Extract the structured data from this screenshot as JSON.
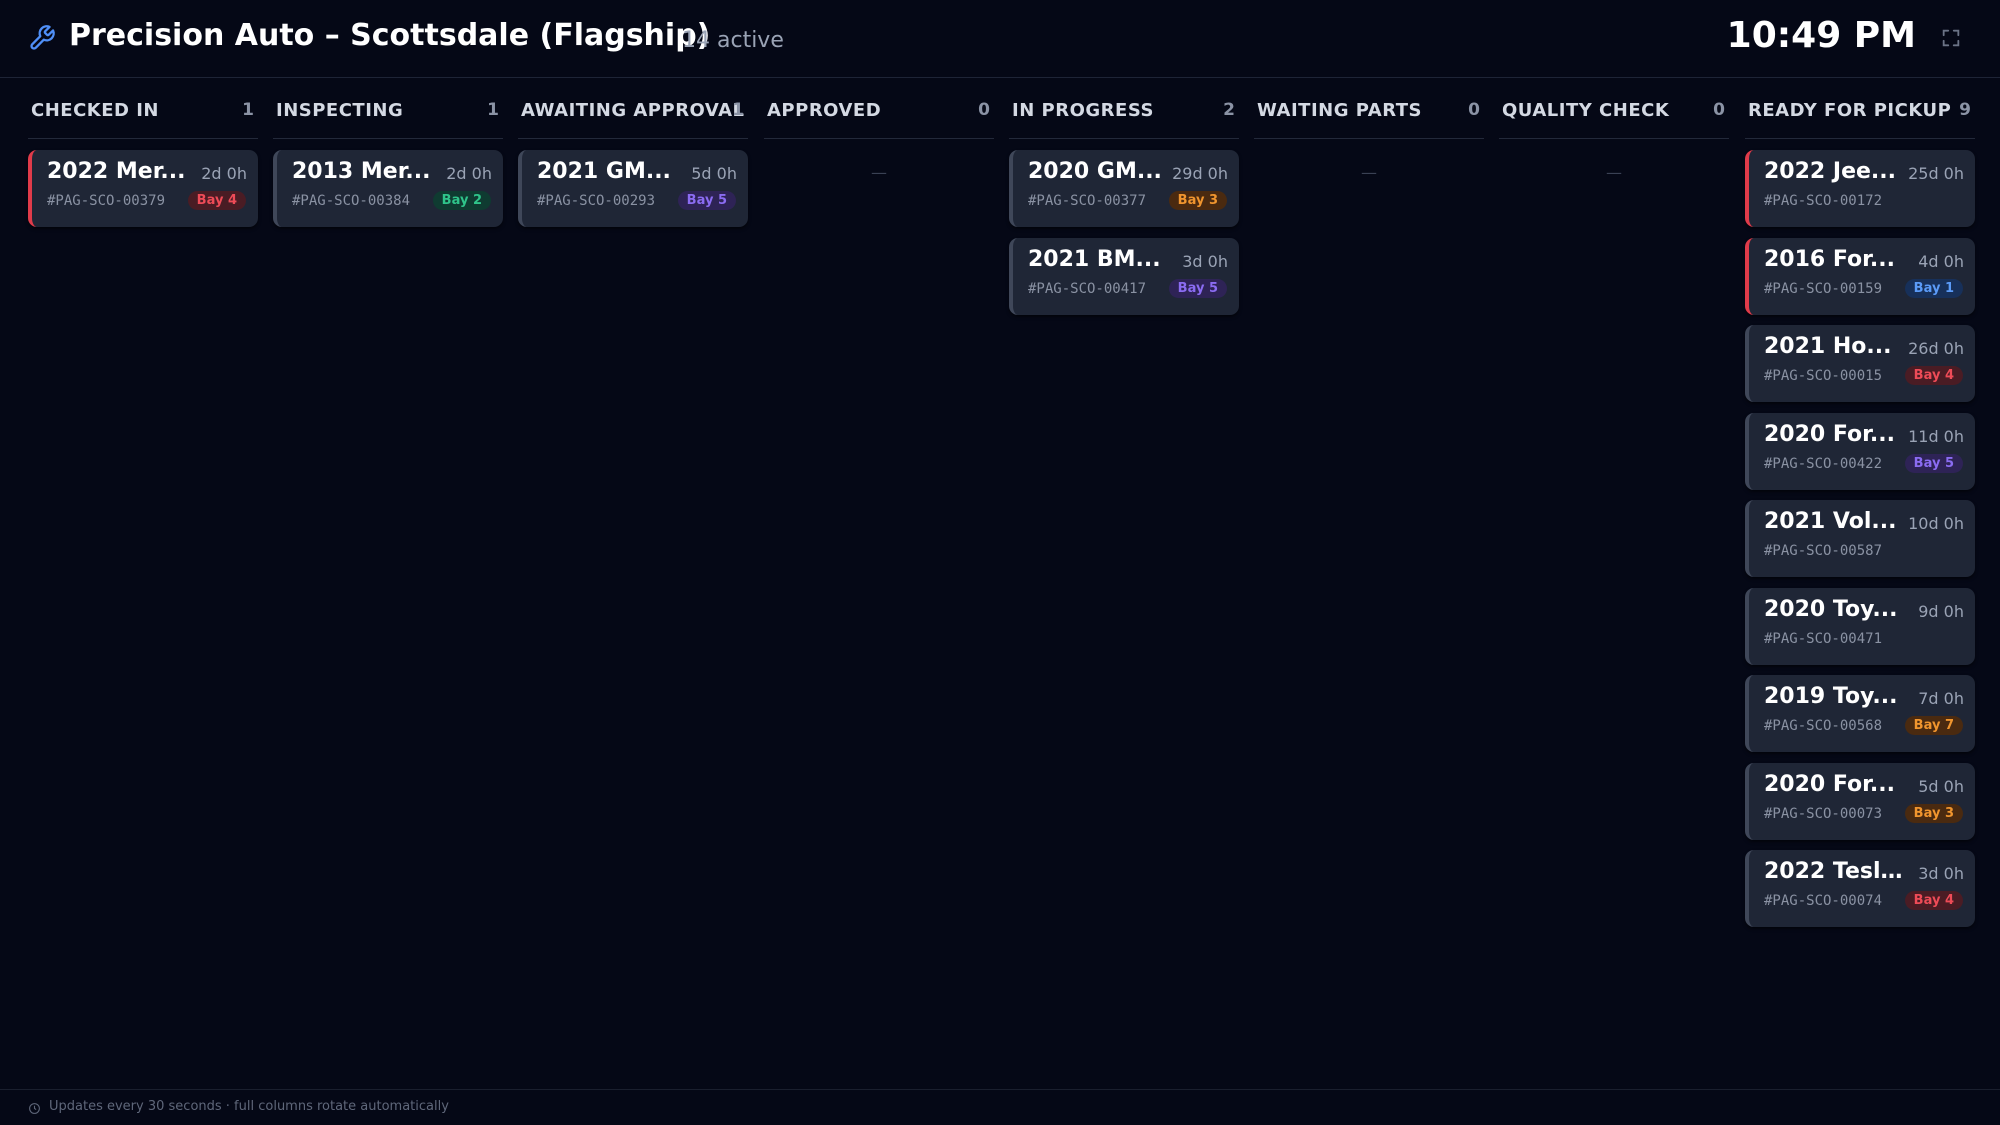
{
  "header": {
    "shop_name": "Precision Auto – Scottsdale (Flagship)",
    "active_count": "14 active",
    "clock": "10:49 PM",
    "icons": {
      "logo": "wrench-icon",
      "fullscreen": "fullscreen-icon"
    }
  },
  "colors": {
    "background": "#050816",
    "card": "#1f2636",
    "urgent": "#e03b4a",
    "accent": "#4f8ff7"
  },
  "columns": [
    {
      "title": "CHECKED IN",
      "count": "1",
      "empty": "—",
      "cards": [
        {
          "title": "2022 Mer...",
          "age": "2d 0h",
          "id": "#PAG-SCO-00379",
          "bay": "Bay 4",
          "urgent": true
        }
      ]
    },
    {
      "title": "INSPECTING",
      "count": "1",
      "empty": "—",
      "cards": [
        {
          "title": "2013 Mer...",
          "age": "2d 0h",
          "id": "#PAG-SCO-00384",
          "bay": "Bay 2",
          "urgent": false
        }
      ]
    },
    {
      "title": "AWAITING APPROVAL",
      "count": "1",
      "empty": "—",
      "cards": [
        {
          "title": "2021 GM...",
          "age": "5d 0h",
          "id": "#PAG-SCO-00293",
          "bay": "Bay 5",
          "urgent": false
        }
      ]
    },
    {
      "title": "APPROVED",
      "count": "0",
      "empty": "—",
      "cards": []
    },
    {
      "title": "IN PROGRESS",
      "count": "2",
      "empty": "—",
      "cards": [
        {
          "title": "2020 GM...",
          "age": "29d 0h",
          "id": "#PAG-SCO-00377",
          "bay": "Bay 3",
          "urgent": false
        },
        {
          "title": "2021 BM...",
          "age": "3d 0h",
          "id": "#PAG-SCO-00417",
          "bay": "Bay 5",
          "urgent": false
        }
      ]
    },
    {
      "title": "WAITING PARTS",
      "count": "0",
      "empty": "—",
      "cards": []
    },
    {
      "title": "QUALITY CHECK",
      "count": "0",
      "empty": "—",
      "cards": []
    },
    {
      "title": "READY FOR PICKUP",
      "count": "9",
      "empty": "—",
      "cards": [
        {
          "title": "2022 Jee...",
          "age": "25d 0h",
          "id": "#PAG-SCO-00172",
          "bay": "",
          "urgent": true
        },
        {
          "title": "2016 For...",
          "age": "4d 0h",
          "id": "#PAG-SCO-00159",
          "bay": "Bay 1",
          "urgent": true
        },
        {
          "title": "2021 Ho...",
          "age": "26d 0h",
          "id": "#PAG-SCO-00015",
          "bay": "Bay 4",
          "urgent": false
        },
        {
          "title": "2020 For...",
          "age": "11d 0h",
          "id": "#PAG-SCO-00422",
          "bay": "Bay 5",
          "urgent": false
        },
        {
          "title": "2021 Vol...",
          "age": "10d 0h",
          "id": "#PAG-SCO-00587",
          "bay": "",
          "urgent": false
        },
        {
          "title": "2020 Toy...",
          "age": "9d 0h",
          "id": "#PAG-SCO-00471",
          "bay": "",
          "urgent": false
        },
        {
          "title": "2019 Toy...",
          "age": "7d 0h",
          "id": "#PAG-SCO-00568",
          "bay": "Bay 7",
          "urgent": false
        },
        {
          "title": "2020 For...",
          "age": "5d 0h",
          "id": "#PAG-SCO-00073",
          "bay": "Bay 3",
          "urgent": false
        },
        {
          "title": "2022 Tesl...",
          "age": "3d 0h",
          "id": "#PAG-SCO-00074",
          "bay": "Bay 4",
          "urgent": false
        }
      ]
    }
  ],
  "bay_colors": {
    "Bay 1": {
      "bg": "#17305a",
      "fg": "#5b9bf8"
    },
    "Bay 2": {
      "bg": "#0f3b31",
      "fg": "#2fc48a"
    },
    "Bay 3": {
      "bg": "#4a2a10",
      "fg": "#f0952e"
    },
    "Bay 4": {
      "bg": "#4a1c24",
      "fg": "#ee4b57"
    },
    "Bay 5": {
      "bg": "#2e2356",
      "fg": "#8b6cf2"
    },
    "Bay 7": {
      "bg": "#4a2a10",
      "fg": "#f0952e"
    }
  },
  "footer": {
    "text": "Updates every 30 seconds · full columns rotate automatically",
    "icon": "clock-icon"
  }
}
